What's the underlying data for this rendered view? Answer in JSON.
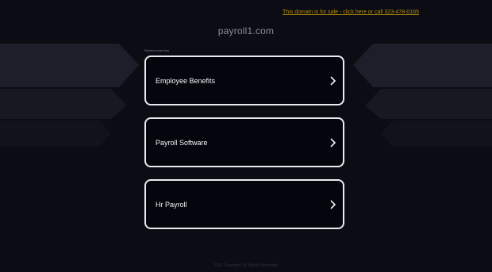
{
  "header": {
    "sale_link": "This domain is for sale - click here or call 323-478-0165",
    "domain": "payroll1.com"
  },
  "related": {
    "label": "Related searches",
    "items": [
      {
        "label": "Employee Benefits"
      },
      {
        "label": "Payroll Software"
      },
      {
        "label": "Hr Payroll"
      }
    ]
  },
  "footer": {
    "text": "2024 Copyright. All Rights Reserved."
  },
  "colors": {
    "background": "#0b0c14",
    "accent_link": "#b58a0c",
    "card_border": "#e9ecef",
    "card_bg": "#05060d"
  },
  "icons": [
    "chevron-right-icon"
  ]
}
